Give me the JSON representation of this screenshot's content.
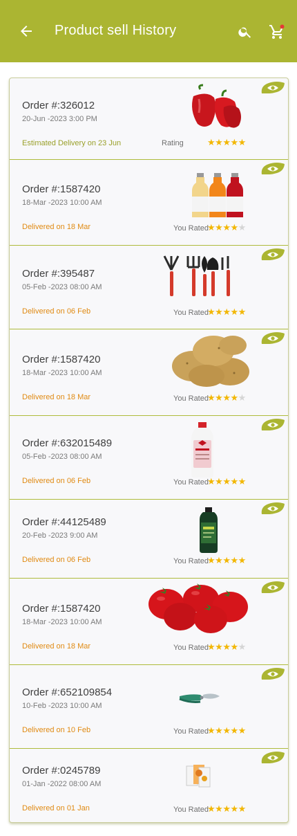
{
  "header": {
    "title": "Product sell History",
    "icons": [
      "back-arrow-icon",
      "search-icon",
      "cart-icon"
    ],
    "background": "#abb532"
  },
  "colors": {
    "accent": "#abb532",
    "delivered": "#e08a12",
    "estimated": "#9aa02a",
    "star": "#f2b705"
  },
  "orders": [
    {
      "id": "Order #:326012",
      "date": "20-Jun -2023 3:00 PM",
      "status": "Estimated  Delivery on 23 Jun",
      "rating_label": "Rating",
      "stars": 5,
      "product": "red-bell-peppers"
    },
    {
      "id": "Order #:1587420",
      "date": "18-Mar -2023 10:00 AM",
      "status": "Delivered on 18 Mar",
      "rating_label": "You Rated",
      "stars": 4,
      "product": "juice-bottles"
    },
    {
      "id": "Order #:395487",
      "date": "05-Feb -2023 08:00 AM",
      "status": "Delivered on 06 Feb",
      "rating_label": "You Rated",
      "stars": 5,
      "product": "garden-tools"
    },
    {
      "id": "Order #:1587420",
      "date": "18-Mar -2023 10:00 AM",
      "status": "Delivered on 18 Mar",
      "rating_label": "You Rated",
      "stars": 4,
      "product": "potatoes"
    },
    {
      "id": "Order #:632015489",
      "date": "05-Feb -2023 08:00 AM",
      "status": "Delivered on 06 Feb",
      "rating_label": "You Rated",
      "stars": 5,
      "product": "fertilizer-bottle"
    },
    {
      "id": "Order #:44125489",
      "date": "20-Feb -2023 9:00 AM",
      "status": "Delivered on 06 Feb",
      "rating_label": "You Rated",
      "stars": 5,
      "product": "pesticide-bottle"
    },
    {
      "id": "Order #:1587420",
      "date": "18-Mar -2023 10:00 AM",
      "status": "Delivered on 18 Mar",
      "rating_label": "You Rated",
      "stars": 4,
      "product": "tomatoes"
    },
    {
      "id": "Order #:652109854",
      "date": "10-Feb -2023 10:00 AM",
      "status": "Delivered on 10 Feb",
      "rating_label": "You Rated",
      "stars": 5,
      "product": "pruning-shears"
    },
    {
      "id": "Order #:0245789",
      "date": "01-Jan -2022 08:00 AM",
      "status": "Delivered on 01 Jan",
      "rating_label": "You Rated",
      "stars": 5,
      "product": "seed-packets"
    }
  ]
}
